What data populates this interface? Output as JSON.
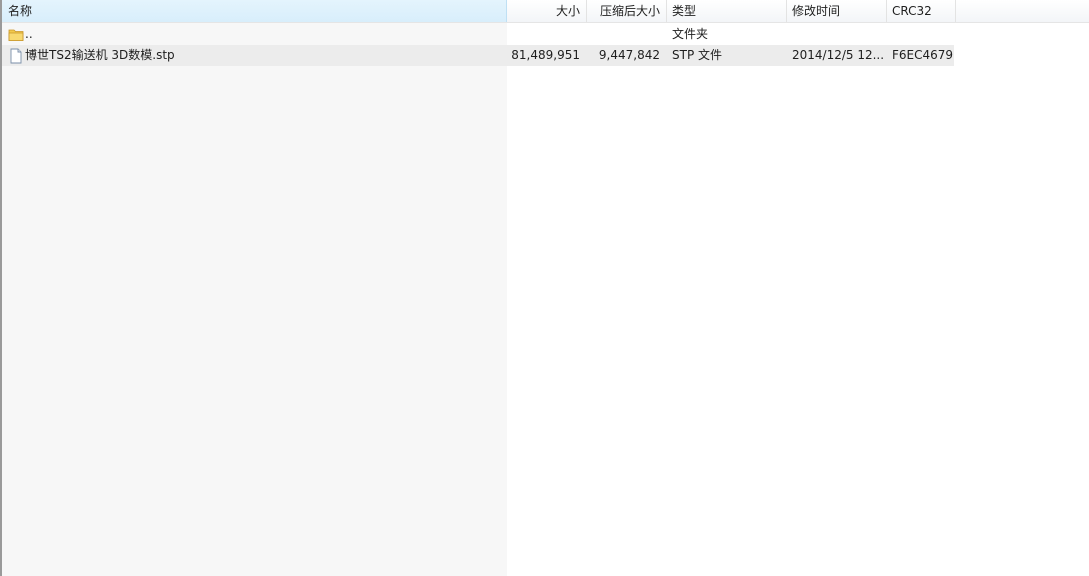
{
  "columns": {
    "name": "名称",
    "size": "大小",
    "packed": "压缩后大小",
    "type": "类型",
    "modified": "修改时间",
    "crc": "CRC32"
  },
  "sort_indicator": "ˆ",
  "rows": [
    {
      "icon": "folder-icon",
      "name": "..",
      "size": "",
      "packed": "",
      "type": "文件夹",
      "modified": "",
      "crc": ""
    },
    {
      "icon": "document-icon",
      "name": "博世TS2输送机 3D数模.stp",
      "size": "81,489,951",
      "packed": "9,447,842",
      "type": "STP 文件",
      "modified": "2014/12/5 12...",
      "crc": "F6EC4679"
    }
  ],
  "colors": {
    "sorted_header": "#d8eefb",
    "selected_row": "#ececec",
    "name_column_bg": "#f7f7f7",
    "folder": "#f2c94c"
  }
}
